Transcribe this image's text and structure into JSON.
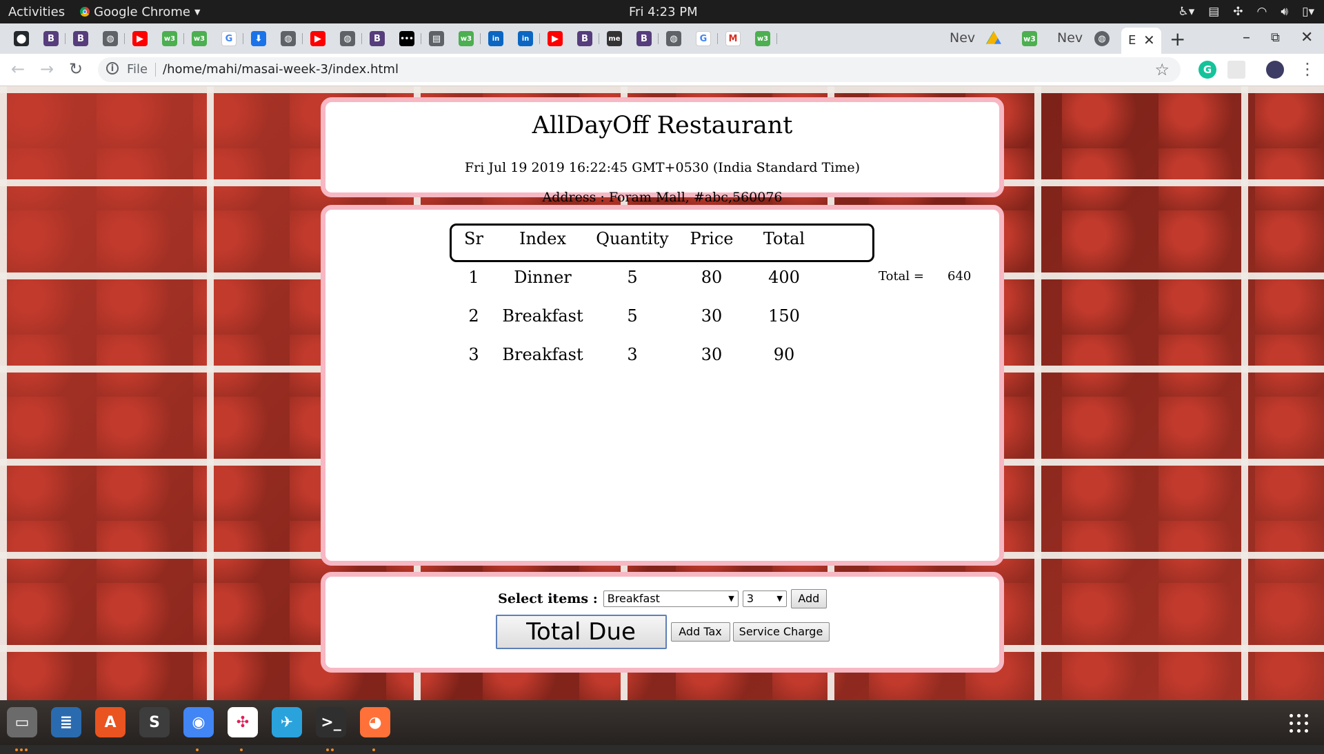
{
  "topbar": {
    "activities": "Activities",
    "app_name": "Google Chrome",
    "clock": "Fri  4:23 PM"
  },
  "tabs": {
    "favicons": [
      {
        "icon": "github-icon",
        "color": "#24292e",
        "glyph": "⬤"
      },
      {
        "icon": "bold-b-icon",
        "color": "#563d7c",
        "glyph": "B"
      },
      {
        "icon": "bold-b-icon",
        "color": "#563d7c",
        "glyph": "B"
      },
      {
        "icon": "globe-icon",
        "color": "#5f6368",
        "glyph": "◍"
      },
      {
        "icon": "youtube-icon",
        "color": "#ff0000",
        "glyph": "▶"
      },
      {
        "icon": "w3schools-icon",
        "color": "#4caf50",
        "glyph": "w3"
      },
      {
        "icon": "w3schools-icon",
        "color": "#4caf50",
        "glyph": "w3"
      },
      {
        "icon": "google-icon",
        "color": "#4285f4",
        "glyph": "G"
      },
      {
        "icon": "download-icon",
        "color": "#1a73e8",
        "glyph": "⬇"
      },
      {
        "icon": "globe-icon",
        "color": "#5f6368",
        "glyph": "◍"
      },
      {
        "icon": "youtube-icon",
        "color": "#ff0000",
        "glyph": "▶"
      },
      {
        "icon": "globe-icon",
        "color": "#5f6368",
        "glyph": "◍"
      },
      {
        "icon": "bold-b-icon",
        "color": "#563d7c",
        "glyph": "B"
      },
      {
        "icon": "dots-icon",
        "color": "#000000",
        "glyph": "•••"
      },
      {
        "icon": "news-icon",
        "color": "#5f6368",
        "glyph": "▤"
      },
      {
        "icon": "w3schools-icon",
        "color": "#4caf50",
        "glyph": "w3"
      },
      {
        "icon": "linkedin-icon",
        "color": "#0a66c2",
        "glyph": "in"
      },
      {
        "icon": "linkedin-icon",
        "color": "#0a66c2",
        "glyph": "in"
      },
      {
        "icon": "youtube-icon",
        "color": "#ff0000",
        "glyph": "▶"
      },
      {
        "icon": "bold-b-icon",
        "color": "#563d7c",
        "glyph": "B"
      },
      {
        "icon": "me-icon",
        "color": "#333333",
        "glyph": "me"
      },
      {
        "icon": "bold-b-icon",
        "color": "#563d7c",
        "glyph": "B"
      },
      {
        "icon": "globe-icon",
        "color": "#5f6368",
        "glyph": "◍"
      },
      {
        "icon": "google-icon",
        "color": "#4285f4",
        "glyph": "G"
      },
      {
        "icon": "gmail-icon",
        "color": "#d93025",
        "glyph": "M"
      },
      {
        "icon": "w3schools-icon",
        "color": "#4caf50",
        "glyph": "w3"
      }
    ],
    "new_tab_label_1": "Nev",
    "drive_icon": "google-drive-icon",
    "new_tab_label_2": "Nev",
    "active_tab_text": "E",
    "close_glyph": "✕",
    "new_tab_glyph": "+"
  },
  "window_controls": {
    "minimize": "–",
    "maximize": "⧉",
    "close": "✕"
  },
  "omnibox": {
    "scheme": "File",
    "url": "/home/mahi/masai-week-3/index.html"
  },
  "restaurant": {
    "name": "AllDayOff Restaurant",
    "datetime": "Fri Jul 19 2019 16:22:45 GMT+0530 (India Standard Time)",
    "address": "Address : Foram Mall, #abc,560076"
  },
  "order_table": {
    "headers": [
      "Sr",
      "Index",
      "Quantity",
      "Price",
      "Total"
    ],
    "rows": [
      [
        "1",
        "Dinner",
        "5",
        "80",
        "400"
      ],
      [
        "2",
        "Breakfast",
        "5",
        "30",
        "150"
      ],
      [
        "3",
        "Breakfast",
        "3",
        "30",
        "90"
      ]
    ]
  },
  "summary": {
    "label": "Total =",
    "value": "640"
  },
  "controls": {
    "select_label": "Select items :",
    "item_selected": "Breakfast",
    "qty_selected": "3",
    "add_label": "Add",
    "total_due_label": "Total Due",
    "add_tax_label": "Add Tax",
    "service_charge_label": "Service Charge"
  },
  "dock": [
    {
      "icon": "files-icon",
      "color": "#6b6b6b"
    },
    {
      "icon": "writer-icon",
      "color": "#2a6bb0"
    },
    {
      "icon": "software-center-icon",
      "color": "#e95420"
    },
    {
      "icon": "sublime-text-icon",
      "color": "#3d3d3d"
    },
    {
      "icon": "chrome-icon",
      "color": "#4285f4"
    },
    {
      "icon": "slack-icon",
      "color": "#ffffff"
    },
    {
      "icon": "telegram-icon",
      "color": "#2aa3dd"
    },
    {
      "icon": "terminal-icon",
      "color": "#2f2f2f"
    },
    {
      "icon": "firefox-icon",
      "color": "#ff7139"
    }
  ]
}
